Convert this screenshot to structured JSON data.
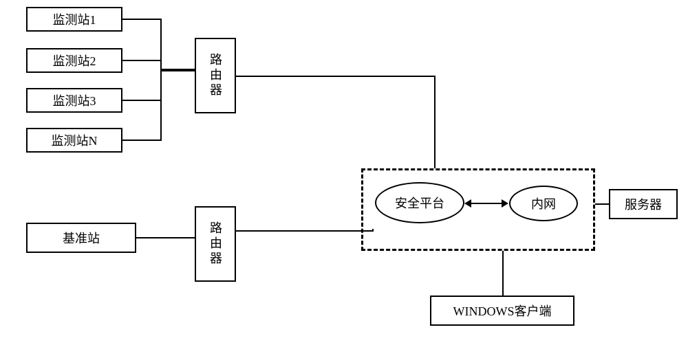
{
  "stations": {
    "s1": "监测站1",
    "s2": "监测站2",
    "s3": "监测站3",
    "sN": "监测站N"
  },
  "router": "路由器",
  "base_station": "基准站",
  "platform": {
    "security": "安全平台",
    "intranet": "内网"
  },
  "server": "服务器",
  "client": "WINDOWS客户端"
}
